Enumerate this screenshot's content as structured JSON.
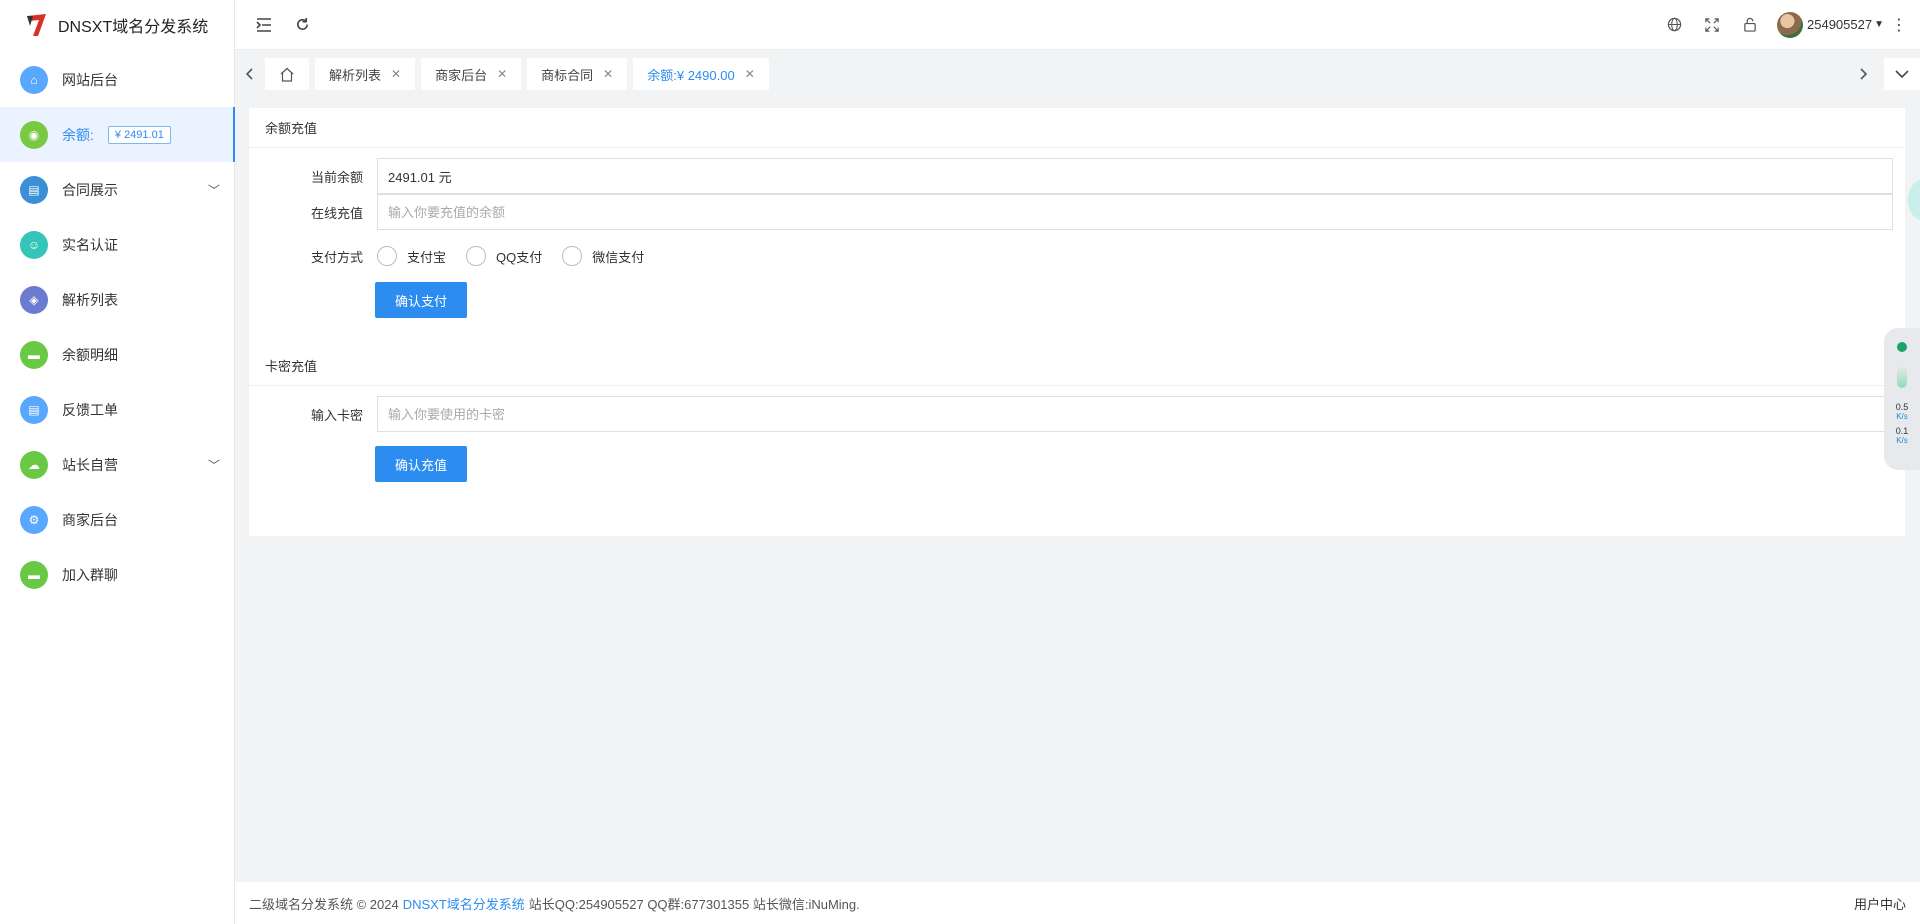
{
  "brand": {
    "title": "DNSXT域名分发系统"
  },
  "sidebar": {
    "items": [
      {
        "label": "网站后台",
        "icon": "home-icon",
        "color": "#5aa7ff"
      },
      {
        "label": "余额:",
        "icon": "wallet-icon",
        "color": "#7ac943",
        "badge": "¥ 2491.01",
        "active": true
      },
      {
        "label": "合同展示",
        "icon": "document-icon",
        "color": "#3a8fd6",
        "expandable": true
      },
      {
        "label": "实名认证",
        "icon": "user-icon",
        "color": "#35c5b8"
      },
      {
        "label": "解析列表",
        "icon": "cube-icon",
        "color": "#6a7bd0"
      },
      {
        "label": "余额明细",
        "icon": "chat-icon",
        "color": "#6ac944"
      },
      {
        "label": "反馈工单",
        "icon": "document-icon",
        "color": "#5aa7ff"
      },
      {
        "label": "站长自营",
        "icon": "cloud-icon",
        "color": "#6ac944",
        "expandable": true
      },
      {
        "label": "商家后台",
        "icon": "gear-icon",
        "color": "#5aa7ff"
      },
      {
        "label": "加入群聊",
        "icon": "chat-icon",
        "color": "#6ac944"
      }
    ]
  },
  "header": {
    "username": "254905527"
  },
  "tabs": [
    {
      "label": "解析列表"
    },
    {
      "label": "商家后台"
    },
    {
      "label": "商标合同"
    },
    {
      "label": "余额:¥ 2490.00",
      "active": true
    }
  ],
  "recharge": {
    "title": "余额充值",
    "current_balance_label": "当前余额",
    "current_balance_value": "2491.01 元",
    "online_label": "在线充值",
    "online_placeholder": "输入你要充值的余额",
    "pay_method_label": "支付方式",
    "pay_methods": [
      "支付宝",
      "QQ支付",
      "微信支付"
    ],
    "confirm_pay": "确认支付"
  },
  "card_recharge": {
    "title": "卡密充值",
    "input_label": "输入卡密",
    "input_placeholder": "输入你要使用的卡密",
    "confirm": "确认充值"
  },
  "footer": {
    "prefix": "二级域名分发系统 © 2024",
    "link": "DNSXT域名分发系统",
    "suffix": "站长QQ:254905527 QQ群:677301355 站长微信:iNuMing.",
    "right": "用户中心"
  },
  "widget": {
    "up": "0.5",
    "up_unit": "K/s",
    "down": "0.1",
    "down_unit": "K/s"
  }
}
